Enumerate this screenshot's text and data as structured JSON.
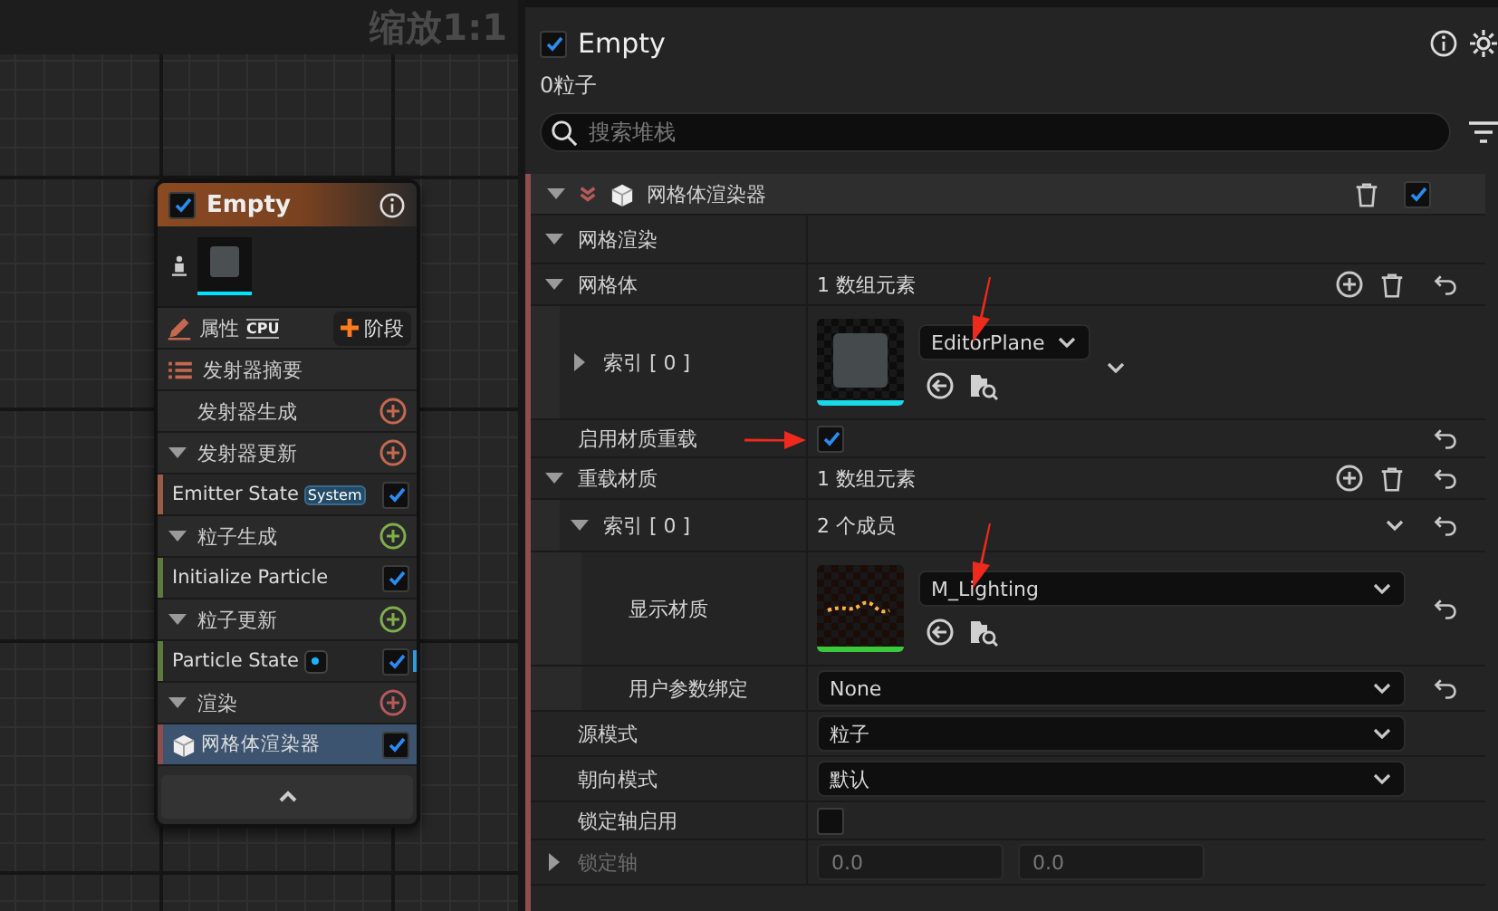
{
  "graph": {
    "zoom_label": "缩放1:1",
    "node": {
      "title": "Empty",
      "enabled": true,
      "properties_label": "属性",
      "sim_target": "CPU",
      "stage_label": "阶段",
      "items": [
        {
          "kind": "summary",
          "label": "发射器摘要"
        },
        {
          "kind": "group",
          "label": "发射器生成",
          "collapsible": false,
          "color": "#c4694f"
        },
        {
          "kind": "group",
          "label": "发射器更新",
          "collapsible": true,
          "color": "#c4694f"
        },
        {
          "kind": "module",
          "label": "Emitter State",
          "badge": "System",
          "dot": false,
          "enabled": true,
          "color": "#9a5c46"
        },
        {
          "kind": "group",
          "label": "粒子生成",
          "collapsible": true,
          "color": "#7fae4c"
        },
        {
          "kind": "module",
          "label": "Initialize Particle",
          "dot": false,
          "enabled": true,
          "color": "#5e7a3e"
        },
        {
          "kind": "group",
          "label": "粒子更新",
          "collapsible": true,
          "color": "#7fae4c"
        },
        {
          "kind": "module",
          "label": "Particle State",
          "dot": true,
          "enabled": true,
          "color": "#5e7a3e"
        },
        {
          "kind": "group",
          "label": "渲染",
          "collapsible": true,
          "color": "#b35a5a"
        },
        {
          "kind": "renderer",
          "label": "网格体渲染器",
          "selected": true,
          "enabled": true,
          "color": "#8e4e4e"
        }
      ]
    }
  },
  "stack": {
    "enabled": true,
    "title": "Empty",
    "particle_count": "0粒子",
    "search": {
      "placeholder": "搜索堆栈"
    },
    "renderer": {
      "label": "网格体渲染器",
      "expanded": true,
      "enabled": true
    },
    "rows": [
      {
        "kind": "section",
        "label": "网格渲染",
        "expanded": true,
        "disabled": false,
        "reset": false,
        "arrow": false
      },
      {
        "kind": "array",
        "label": "网格体",
        "value": "1 数组元素",
        "expanded": true,
        "disabled": false,
        "reset": true,
        "arrow": false,
        "children": [
          {
            "kind": "mesh-asset",
            "label": "索引 [ 0 ]",
            "expanded": false,
            "asset": "EditorPlane",
            "expandable": true,
            "disabled": false,
            "reset": false,
            "arrow": true
          }
        ]
      },
      {
        "kind": "check",
        "label": "启用材质重载",
        "checked": true,
        "disabled": false,
        "reset": true,
        "arrow": true
      },
      {
        "kind": "array",
        "label": "重载材质",
        "value": "1 数组元素",
        "expanded": true,
        "disabled": false,
        "reset": true,
        "arrow": false,
        "children": [
          {
            "kind": "struct",
            "label": "索引 [ 0 ]",
            "value": "2 个成员",
            "expanded": true,
            "disabled": false,
            "reset": true,
            "arrow": false,
            "children": [
              {
                "kind": "material-asset",
                "label": "显示材质",
                "asset": "M_Lighting",
                "expandable": false,
                "disabled": false,
                "reset": true,
                "arrow": true
              },
              {
                "kind": "select",
                "label": "用户参数绑定",
                "value": "None",
                "disabled": false,
                "reset": true,
                "arrow": false
              }
            ]
          }
        ]
      },
      {
        "kind": "select",
        "label": "源模式",
        "value": "粒子",
        "disabled": false,
        "reset": false,
        "arrow": false
      },
      {
        "kind": "select",
        "label": "朝向模式",
        "value": "默认",
        "disabled": false,
        "reset": false,
        "arrow": false
      },
      {
        "kind": "check",
        "label": "锁定轴启用",
        "checked": false,
        "disabled": false,
        "reset": false,
        "arrow": false
      },
      {
        "kind": "vector",
        "label": "锁定轴",
        "values": [
          "0.0",
          "0.0"
        ],
        "expanded": false,
        "disabled": true,
        "reset": false,
        "arrow": false
      }
    ]
  }
}
